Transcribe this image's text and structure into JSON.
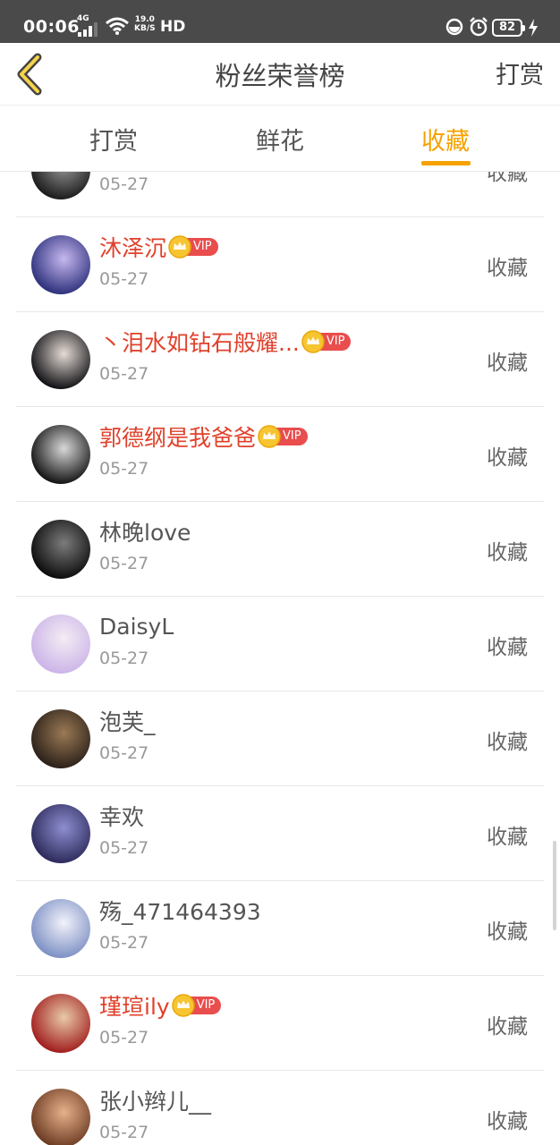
{
  "status_bar": {
    "time": "00:06",
    "network": "4G",
    "speed_value": "19.0",
    "speed_unit": "KB/S",
    "hd": "HD",
    "battery": "82"
  },
  "header": {
    "title": "粉丝荣誉榜",
    "action_label": "打赏",
    "back_icon": "chevron-left-icon"
  },
  "tabs": [
    {
      "label": "打赏",
      "active": false
    },
    {
      "label": "鲜花",
      "active": false
    },
    {
      "label": "收藏",
      "active": true
    }
  ],
  "colors": {
    "accent": "#f5a200",
    "vip_name": "#e0412b",
    "vip_badge": "#e94d4d",
    "crown": "#f7c531"
  },
  "vip_label": "VIP",
  "rows": [
    {
      "name": "",
      "date": "05-27",
      "action": "收藏",
      "vip": false,
      "avatar_colors": [
        "#1a1a1a",
        "#9a9a9a"
      ]
    },
    {
      "name": "沐泽沉",
      "date": "05-27",
      "action": "收藏",
      "vip": true,
      "avatar_colors": [
        "#2b2f7a",
        "#c7b8f0"
      ]
    },
    {
      "name": "丶泪水如钻石般耀...",
      "date": "05-27",
      "action": "收藏",
      "vip": true,
      "avatar_colors": [
        "#0e0e12",
        "#e6dcd6"
      ]
    },
    {
      "name": "郭德纲是我爸爸",
      "date": "05-27",
      "action": "收藏",
      "vip": true,
      "avatar_colors": [
        "#111111",
        "#d8d8d8"
      ]
    },
    {
      "name": "林晚love",
      "date": "05-27",
      "action": "收藏",
      "vip": false,
      "avatar_colors": [
        "#0b0b0b",
        "#7c7c7c"
      ]
    },
    {
      "name": "DaisyL",
      "date": "05-27",
      "action": "收藏",
      "vip": false,
      "avatar_colors": [
        "#cbb4e8",
        "#f4ecf4"
      ]
    },
    {
      "name": "泡芙_",
      "date": "05-27",
      "action": "收藏",
      "vip": false,
      "avatar_colors": [
        "#2a1f18",
        "#9a7a55"
      ]
    },
    {
      "name": "幸欢",
      "date": "05-27",
      "action": "收藏",
      "vip": false,
      "avatar_colors": [
        "#2c2a5a",
        "#8e8ed0"
      ]
    },
    {
      "name": "殇_471464393",
      "date": "05-27",
      "action": "收藏",
      "vip": false,
      "avatar_colors": [
        "#7c8fc4",
        "#f2f2fa"
      ]
    },
    {
      "name": "瑾瑄ily",
      "date": "05-27",
      "action": "收藏",
      "vip": true,
      "avatar_colors": [
        "#a01c1c",
        "#e8c9a8"
      ]
    },
    {
      "name": "张小辫儿__",
      "date": "05-27",
      "action": "收藏",
      "vip": false,
      "avatar_colors": [
        "#6a3a22",
        "#e7b08a"
      ]
    }
  ]
}
